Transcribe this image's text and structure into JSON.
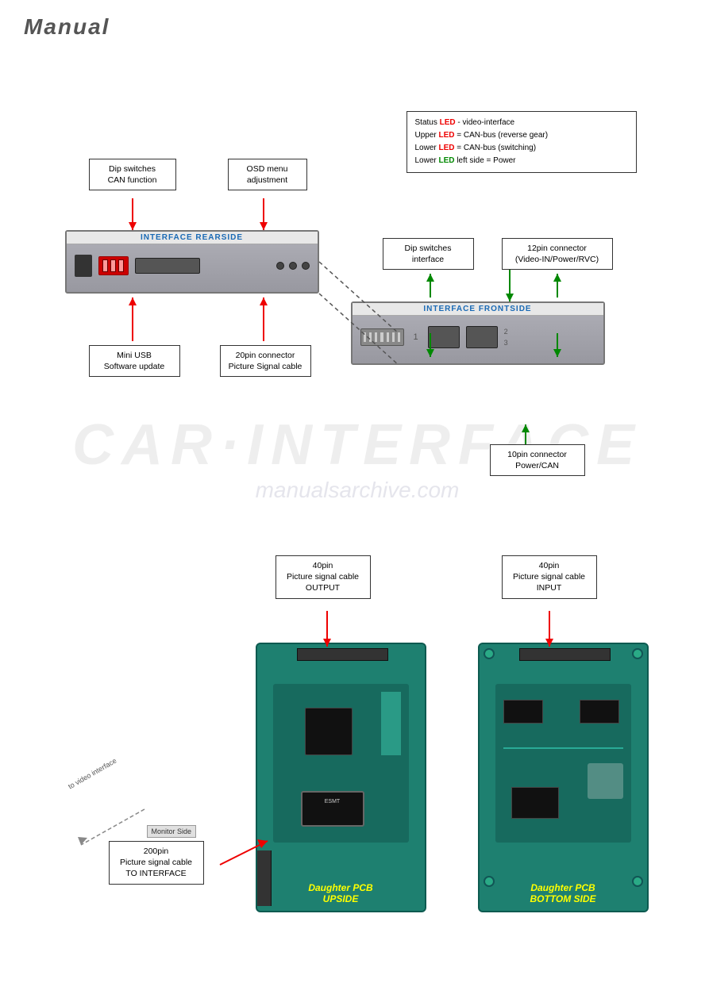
{
  "title": "Manual",
  "top_diagram": {
    "status_box": {
      "line1": "Status LED - video-interface",
      "line2": "Upper LED = CAN-bus (reverse gear)",
      "line3": "Lower LED = CAN-bus (switching)",
      "line4": "Lower LED left side = Power"
    },
    "callouts": {
      "dip_can": {
        "line1": "Dip switches",
        "line2": "CAN function"
      },
      "osd_menu": {
        "line1": "OSD menu",
        "line2": "adjustment"
      },
      "dip_interface": {
        "line1": "Dip switches",
        "line2": "interface"
      },
      "pin12": {
        "line1": "12pin connector",
        "line2": "(Video-IN/Power/RVC)"
      },
      "mini_usb": {
        "line1": "Mini USB",
        "line2": "Software update"
      },
      "pin20": {
        "line1": "20pin connector",
        "line2": "Picture Signal cable"
      },
      "pin10": {
        "line1": "10pin connector",
        "line2": "Power/CAN"
      }
    },
    "rearside_label": "INTERFACE  REARSIDE",
    "frontside_label": "INTERFACE FRONTSIDE"
  },
  "bottom_diagram": {
    "callout_left": {
      "line1": "40pin",
      "line2": "Picture signal cable",
      "line3": "OUTPUT"
    },
    "callout_right": {
      "line1": "40pin",
      "line2": "Picture signal cable",
      "line3": "INPUT"
    },
    "callout_200pin": {
      "line1": "200pin",
      "line2": "Picture signal cable",
      "line3": "TO INTERFACE"
    },
    "monitor_label": "Monitor Side",
    "to_video": "to video interface",
    "pcb_left_label1": "Daughter PCB",
    "pcb_left_label2": "UPSIDE",
    "pcb_right_label1": "Daughter PCB",
    "pcb_right_label2": "BOTTOM SIDE"
  }
}
